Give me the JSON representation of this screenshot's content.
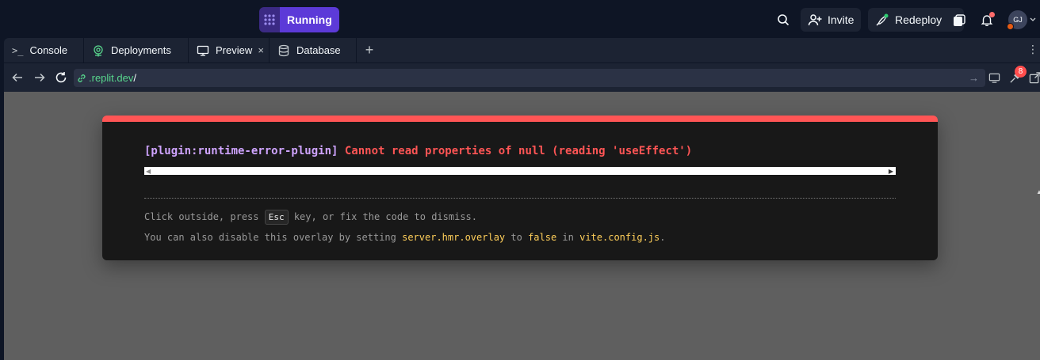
{
  "run_button": {
    "label": "Running"
  },
  "header": {
    "invite_label": "Invite",
    "redeploy_label": "Redeploy",
    "avatar_initials": "GJ"
  },
  "tabs": [
    {
      "label": "Console",
      "icon": "terminal-icon"
    },
    {
      "label": "Deployments",
      "icon": "deployments-icon"
    },
    {
      "label": "Preview",
      "icon": "monitor-icon",
      "active": true,
      "close": "×"
    },
    {
      "label": "Database",
      "icon": "database-icon"
    }
  ],
  "tab_add_label": "+",
  "address": {
    "url": ".replit.dev",
    "slash": "/"
  },
  "devtools_badge": "8",
  "error_overlay": {
    "plugin": "[plugin:runtime-error-plugin]",
    "message": "Cannot read properties of null (reading 'useEffect')",
    "tip1_before": "Click outside, press ",
    "tip1_key": "Esc",
    "tip1_after": " key, or fix the code to dismiss.",
    "tip2_before": "You can also disable this overlay by setting ",
    "tip2_code1": "server.hmr.overlay",
    "tip2_mid1": " to ",
    "tip2_code2": "false",
    "tip2_mid2": " in ",
    "tip2_code3": "vite.config.js",
    "tip2_end": "."
  },
  "colors": {
    "accent": "#5c3ad8",
    "error": "#ff5555",
    "plugin": "#cfa4ff",
    "code": "#ffcf5a",
    "url": "#58d68d"
  }
}
